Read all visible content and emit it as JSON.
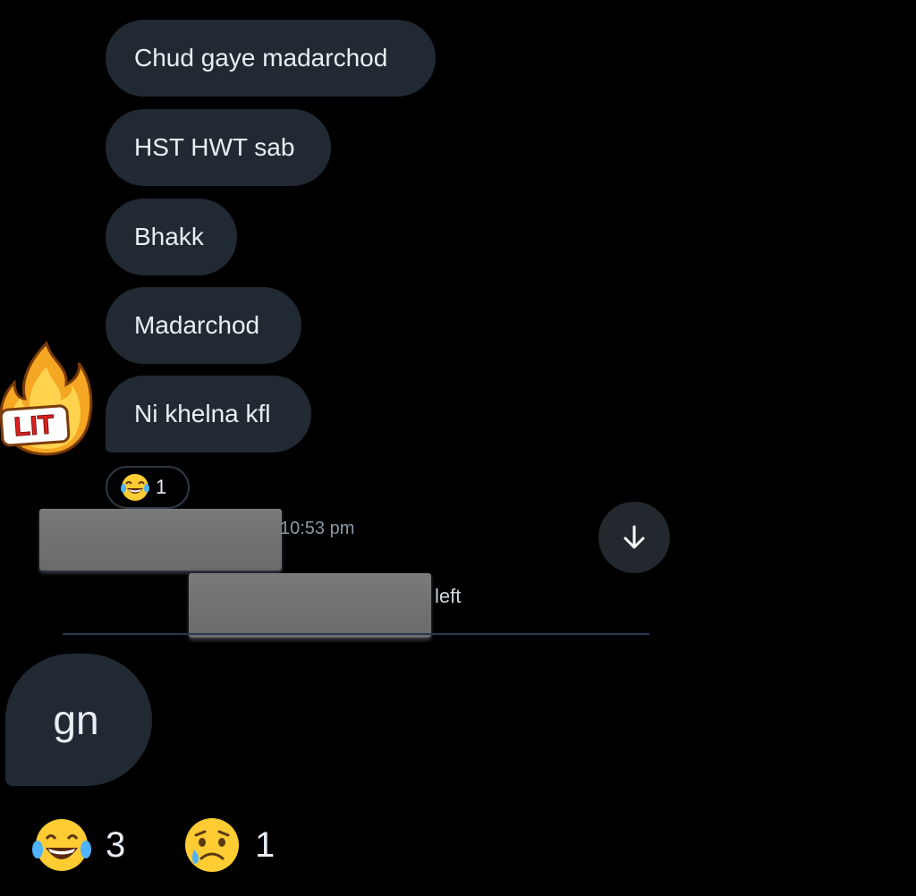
{
  "messages": [
    {
      "text": "Chud gaye madarchod"
    },
    {
      "text": "HST HWT sab"
    },
    {
      "text": "Bhakk"
    },
    {
      "text": "Madarchod"
    },
    {
      "text": "Ni khelna kfl"
    }
  ],
  "sticker": {
    "label": "LIT",
    "icon": "fire-lit-sticker"
  },
  "message_reaction": {
    "emoji": "tears-of-joy",
    "count": "1"
  },
  "meta": {
    "time": "10:53 pm",
    "status": "left"
  },
  "scroll_down": {
    "icon": "arrow-down-icon"
  },
  "last_message": {
    "text": "gn"
  },
  "last_reactions": [
    {
      "emoji": "tears-of-joy",
      "count": "3"
    },
    {
      "emoji": "crying-face",
      "count": "1"
    }
  ],
  "colors": {
    "background": "#000000",
    "bubble": "#212a33",
    "text": "#e9eef3",
    "meta": "#8b98a5"
  }
}
